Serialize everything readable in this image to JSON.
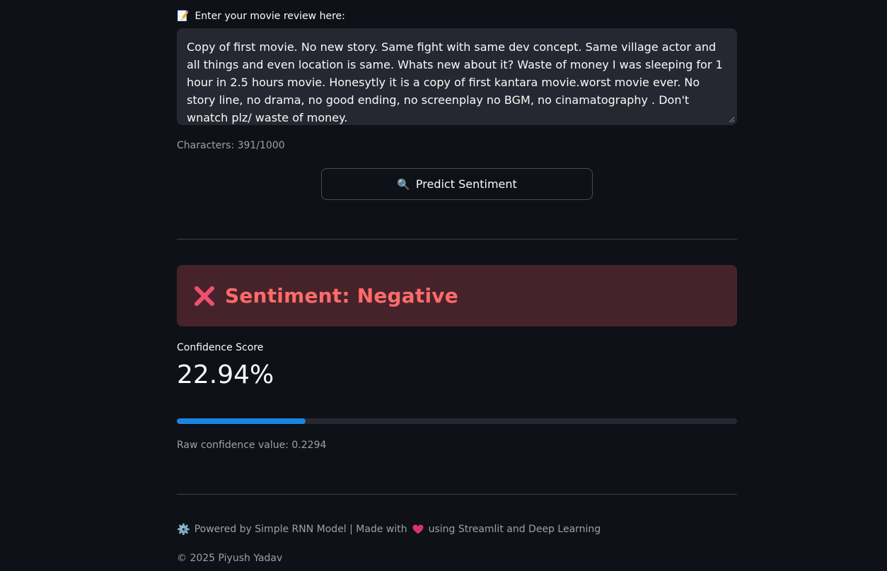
{
  "input": {
    "label": "Enter your movie review here:",
    "label_icon": "memo-icon",
    "value": "Copy of first movie. No new story. Same fight with same dev concept. Same village actor and all things and even location is same. Whats new about it? Waste of money I was sleeping for 1 hour in 2.5 hours movie. Honesytly it is a copy of first kantara movie.worst movie ever. No story line, no drama, no good ending, no screenplay no BGM, no cinamatography . Don't wnatch plz/ waste of money.",
    "char_count": "Characters: 391/1000"
  },
  "predict_button": {
    "icon": "magnifier-icon",
    "label": "Predict Sentiment"
  },
  "result": {
    "icon": "cross-mark-icon",
    "text": "Sentiment: Negative",
    "color": "#ff6b6b",
    "background": "#46232a"
  },
  "confidence": {
    "label": "Confidence Score",
    "value_text": "22.94%",
    "progress": 0.2294,
    "bar_color": "#1c83e1",
    "raw_text": "Raw confidence value: 0.2294"
  },
  "footer": {
    "icon": "gear-icon",
    "text_before": "Powered by Simple RNN Model | Made with",
    "heart_icon": "heart-icon",
    "text_after": "using Streamlit and Deep Learning",
    "copyright": "© 2025 Piyush Yadav"
  },
  "theme": {
    "background": "#0e1117",
    "surface": "#262730",
    "text": "#fafafa",
    "muted": "#9ea0a8"
  }
}
